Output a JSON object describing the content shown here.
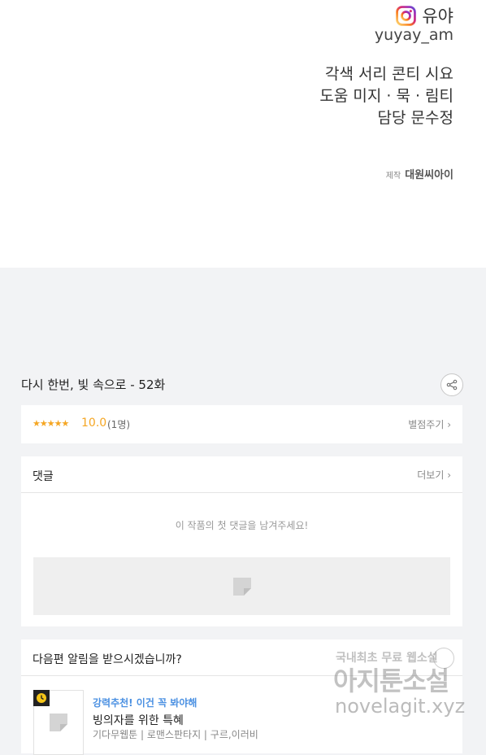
{
  "credits": {
    "author_name": "유야",
    "author_handle": "yuyay_am",
    "lines": [
      "각색 서리 콘티 시요",
      "도움 미지 · 묵 · 림티",
      "담당 문수정"
    ],
    "producer_label": "제작",
    "producer_name": "대원씨아이"
  },
  "episode": {
    "title": "다시 한번, 빛 속으로 - 52화",
    "share_icon": "share-icon"
  },
  "rating": {
    "stars": "★★★★★",
    "score": "10.0",
    "count": "(1명)",
    "rate_label": "별점주기 ›"
  },
  "comments": {
    "title": "댓글",
    "more_label": "더보기 ›",
    "empty_message": "이 작품의 첫 댓글을 남겨주세요!"
  },
  "notify": {
    "title": "다음편 알림을 받으시겠습니까?",
    "recommend_tag": "강력추천! 이건 꼭 봐야해",
    "recommend_title": "빙의자를 위한 특혜",
    "recommend_genre": "기다무웹툰 | 로맨스판타지 | 구르,이러비"
  },
  "watermark": {
    "line1": "국내최초 무료 웹소설",
    "line2": "아지툰소설",
    "line3": "novelagit.xyz"
  },
  "colors": {
    "accent_star": "#f5a623",
    "link_blue": "#4a90e2",
    "background": "#f2f3f5"
  }
}
